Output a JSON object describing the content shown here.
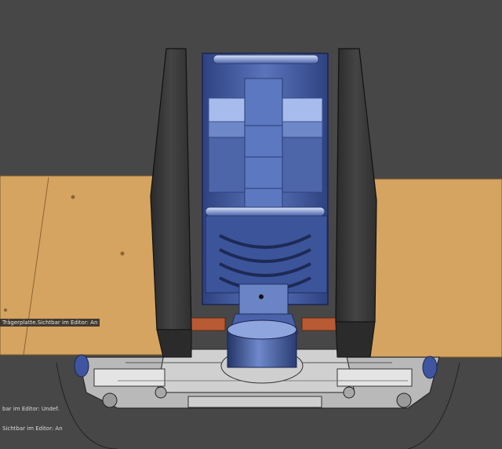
{
  "viewport": {
    "background": "#474747",
    "colors": {
      "plate": "#d4a460",
      "plate_edge": "#8a6534",
      "machine_blue": "#5570b5",
      "machine_blue_light": "#9eb4e6",
      "machine_blue_dark": "#2c3f78",
      "side_panel": "#3c3c3c",
      "chassis": "#c8c8c8",
      "lift_orange": "#b85a34"
    }
  },
  "labels": {
    "traegerplatte": "Trägerplatte.Sichtbar im Editor: An",
    "undef": "bar im Editor: Undef.",
    "an": "Sichtbar im Editor: An"
  }
}
